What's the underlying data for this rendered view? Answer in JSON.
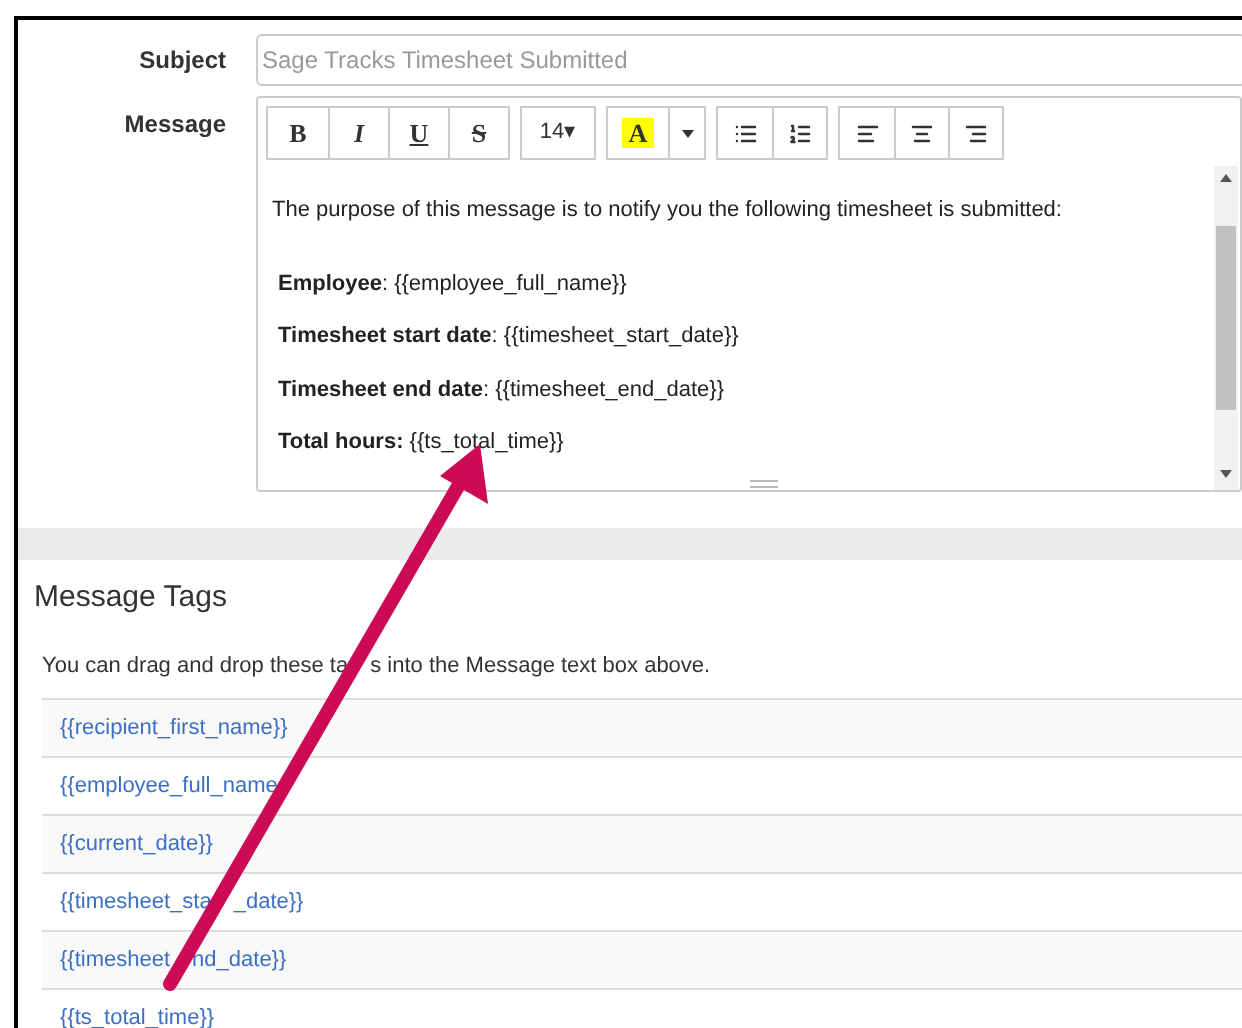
{
  "form": {
    "subject": {
      "label": "Subject",
      "placeholder": "Sage Tracks Timesheet Submitted"
    },
    "message": {
      "label": "Message",
      "toolbar": [
        {
          "buttons": [
            {
              "kind": "bold",
              "label": "B"
            },
            {
              "kind": "italic",
              "label": "I"
            },
            {
              "kind": "underline",
              "label": "U"
            },
            {
              "kind": "strike",
              "label": "S"
            }
          ]
        },
        {
          "buttons": [
            {
              "kind": "size",
              "label": "14▾"
            }
          ]
        },
        {
          "buttons": [
            {
              "kind": "color",
              "label": "A"
            },
            {
              "kind": "caret"
            }
          ]
        },
        {
          "buttons": [
            {
              "kind": "bullets"
            },
            {
              "kind": "numbers"
            }
          ]
        },
        {
          "buttons": [
            {
              "kind": "align-left"
            },
            {
              "kind": "align-center"
            },
            {
              "kind": "align-right"
            }
          ]
        }
      ],
      "body": [
        "The purpose of this message is to notify you the following timesheet is submitted:",
        "**Employee**: {{employee_full_name}}",
        "**Timesheet start date**: {{timesheet_start_date}}",
        "**Timesheet end date**: {{timesheet_end_date}}",
        "**Total hours:** {{ts_total_time}}"
      ]
    }
  },
  "message_tags": {
    "title": "Message Tags",
    "description": [
      "You can drag and drop these ta",
      "s into the Message text box above."
    ],
    "tags": [
      [
        "{{recipient_first_name}}"
      ],
      [
        "{{employee_full_name"
      ],
      [
        "{{current_date}}"
      ],
      [
        "{{timesheet_sta",
        "_date}}"
      ],
      [
        "{{timesheet",
        "nd_date}}"
      ],
      [
        "{{ts_total_time}}"
      ]
    ]
  }
}
